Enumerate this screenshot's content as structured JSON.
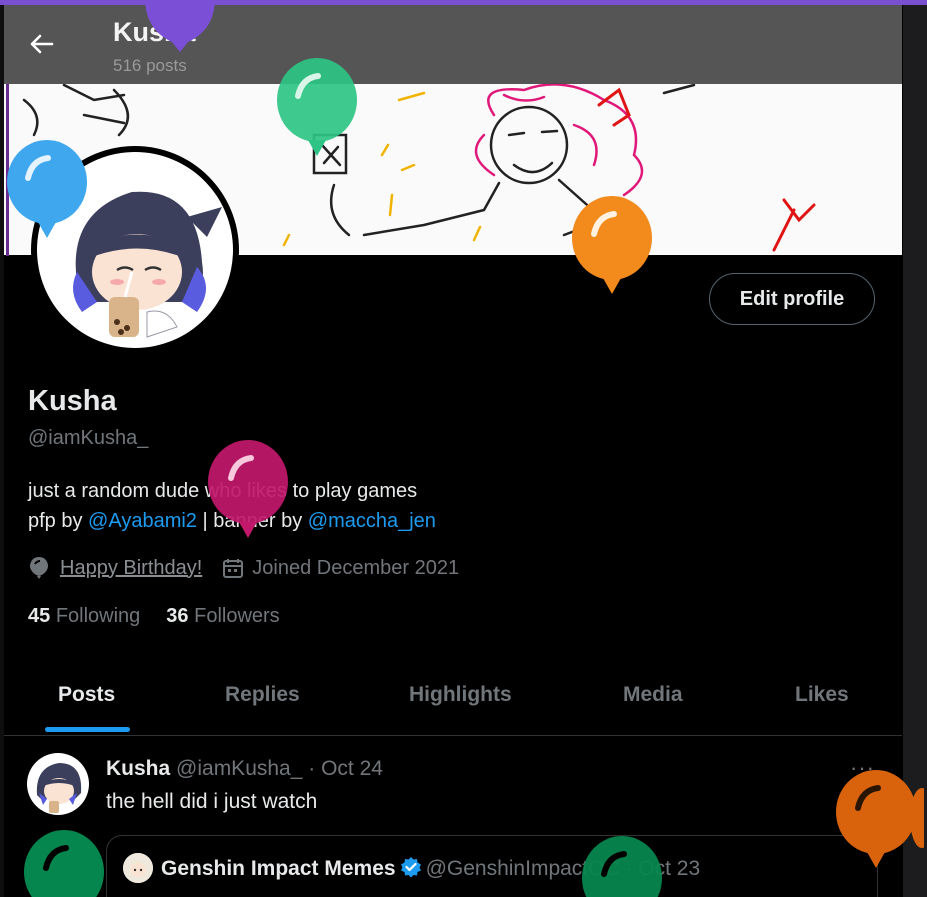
{
  "header": {
    "name": "Kusha",
    "post_count": "516 posts"
  },
  "profile": {
    "display_name": "Kusha",
    "handle": "@iamKusha_",
    "edit_button": "Edit profile",
    "bio_line1": "just a random dude who likes to play games",
    "bio_line2_prefix": "pfp by ",
    "bio_link1": "@Ayabami2",
    "bio_line2_mid": " | banner by ",
    "bio_link2": "@maccha_jen",
    "birthday": "Happy Birthday!",
    "joined": "Joined December 2021",
    "following_count": "45",
    "following_label": "Following",
    "followers_count": "36",
    "followers_label": "Followers"
  },
  "tabs": [
    "Posts",
    "Replies",
    "Highlights",
    "Media",
    "Likes"
  ],
  "active_tab": "Posts",
  "post": {
    "author": "Kusha",
    "handle": "@iamKusha_",
    "sep_date": " · Oct 24",
    "text": "the hell did i just watch",
    "more": "···",
    "quote": {
      "author": "Genshin Impact Memes",
      "handle": "@GenshinImpactOC",
      "sep_date": " · Oct 23"
    }
  },
  "colors": {
    "accent": "#1d9bf0",
    "balloon_purple": "#7b4fd6",
    "balloon_green": "#2ec486",
    "balloon_blue": "#3fa7ee",
    "balloon_orange": "#f28a1c",
    "balloon_magenta": "#c2186b",
    "balloon_dark_green": "#06864f",
    "balloon_dark_orange": "#d9630c"
  },
  "icons": [
    "back-arrow-icon",
    "balloon-icon",
    "calendar-icon",
    "verified-badge-icon",
    "more-dots-icon"
  ]
}
